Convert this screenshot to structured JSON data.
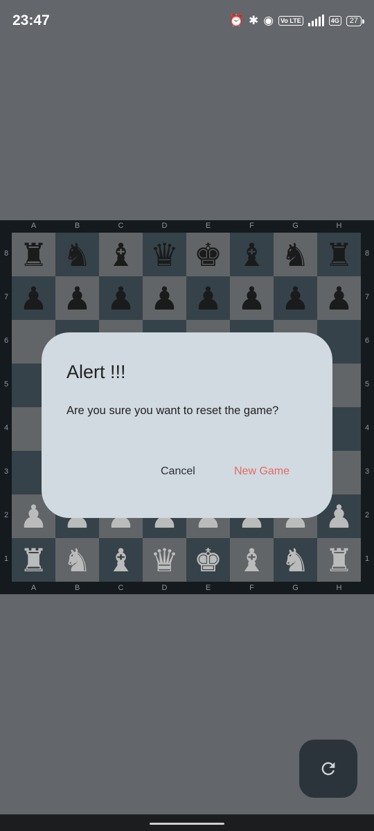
{
  "status_bar": {
    "time": "23:47",
    "icons": [
      "alarm-icon",
      "bluetooth-icon",
      "hotspot-icon",
      "volte-icon",
      "signal-icon",
      "network-4g-icon",
      "battery-icon"
    ],
    "volte": "Vo LTE",
    "network": "4G",
    "battery": "27"
  },
  "board": {
    "files": [
      "A",
      "B",
      "C",
      "D",
      "E",
      "F",
      "G",
      "H"
    ],
    "ranks": [
      "8",
      "7",
      "6",
      "5",
      "4",
      "3",
      "2",
      "1"
    ],
    "colors": {
      "light": "#63666a",
      "dark": "#2e3b44"
    },
    "pieces": [
      [
        "br",
        "bn",
        "bb",
        "bq",
        "bk",
        "bb",
        "bn",
        "br"
      ],
      [
        "bp",
        "bp",
        "bp",
        "bp",
        "bp",
        "bp",
        "bp",
        "bp"
      ],
      [
        "",
        "",
        "",
        "",
        "",
        "",
        "",
        ""
      ],
      [
        "",
        "",
        "",
        "",
        "",
        "",
        "",
        ""
      ],
      [
        "",
        "",
        "",
        "",
        "",
        "",
        "",
        ""
      ],
      [
        "",
        "",
        "",
        "",
        "",
        "",
        "",
        ""
      ],
      [
        "wp",
        "wp",
        "wp",
        "wp",
        "wp",
        "wp",
        "wp",
        "wp"
      ],
      [
        "wr",
        "wn",
        "wb",
        "wq",
        "wk",
        "wb",
        "wn",
        "wr"
      ]
    ]
  },
  "dialog": {
    "title": "Alert !!!",
    "message": "Are you sure you want to reset the game?",
    "cancel_label": "Cancel",
    "confirm_label": "New Game",
    "confirm_color": "#e36b63"
  },
  "fab": {
    "icon": "refresh-icon"
  }
}
